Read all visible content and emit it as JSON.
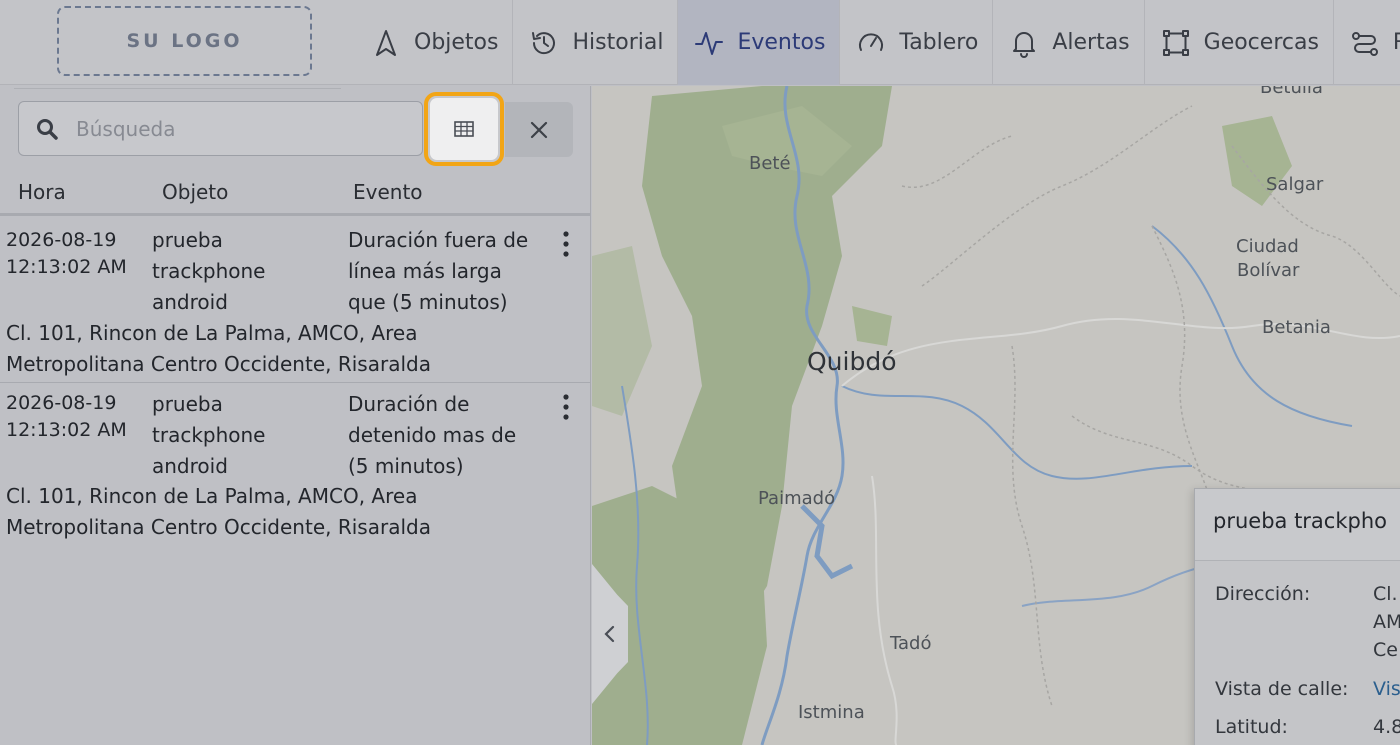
{
  "logo": {
    "text": "SU LOGO"
  },
  "nav": {
    "items": [
      {
        "label": "Objetos",
        "icon": "navigation-arrow-icon"
      },
      {
        "label": "Historial",
        "icon": "history-icon"
      },
      {
        "label": "Eventos",
        "icon": "activity-pulse-icon",
        "active": true
      },
      {
        "label": "Tablero",
        "icon": "gauge-icon"
      },
      {
        "label": "Alertas",
        "icon": "bell-icon"
      },
      {
        "label": "Geocercas",
        "icon": "geofence-icon"
      },
      {
        "label": "R",
        "icon": "route-icon"
      }
    ]
  },
  "search": {
    "placeholder": "Búsqueda",
    "value": ""
  },
  "table": {
    "headers": {
      "time": "Hora",
      "object": "Objeto",
      "event": "Evento"
    },
    "rows": [
      {
        "date": "2026-08-19",
        "time": "12:13:02 AM",
        "object": [
          "prueba",
          "trackphone",
          "android"
        ],
        "event": [
          "Duración fuera de",
          "línea más larga",
          "que (5 minutos)"
        ],
        "address": [
          "Cl. 101, Rincon de La Palma, AMCO, Area",
          "Metropolitana Centro Occidente, Risaralda"
        ]
      },
      {
        "date": "2026-08-19",
        "time": "12:13:02 AM",
        "object": [
          "prueba",
          "trackphone",
          "android"
        ],
        "event": [
          "Duración de",
          "detenido mas de",
          "(5 minutos)"
        ],
        "address": [
          "Cl. 101, Rincon de La Palma, AMCO, Area",
          "Metropolitana Centro Occidente, Risaralda"
        ]
      }
    ]
  },
  "map": {
    "labels": {
      "betulia": "Betulia",
      "bete": "Beté",
      "salgar": "Salgar",
      "ciudad": "Ciudad",
      "bolivar": "Bolívar",
      "betania": "Betania",
      "quibdo": "Quibdó",
      "paimado": "Paimadó",
      "tado": "Tadó",
      "istmina": "Istmina"
    }
  },
  "popup": {
    "title": "prueba trackpho",
    "direccion_label": "Dirección:",
    "direccion_value": [
      "Cl.",
      "AM",
      "Ce"
    ],
    "vista_label": "Vista de calle:",
    "vista_value": "Vis",
    "latitud_label": "Latitud:",
    "latitud_value": "4.8"
  },
  "colors": {
    "accent": "#2c3a77",
    "highlight": "#f2a516",
    "link": "#2b5f8e"
  }
}
